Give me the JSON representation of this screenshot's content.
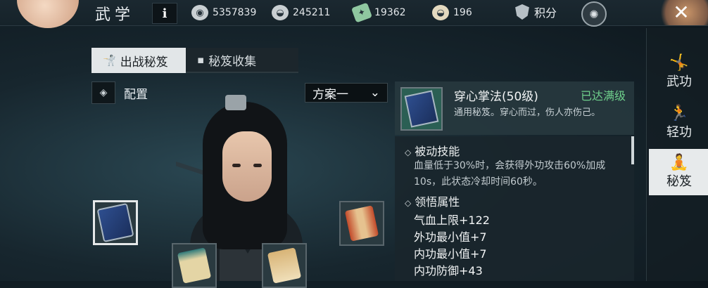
{
  "header": {
    "title": "武学",
    "info_label": "i",
    "resources": [
      {
        "icon": "coin-film-icon",
        "value": "5357839"
      },
      {
        "icon": "silver-ingot-icon",
        "value": "245211"
      },
      {
        "icon": "jade-ticket-icon",
        "value": "19362"
      },
      {
        "icon": "gold-ingot-icon",
        "value": "196"
      }
    ],
    "score_label": "积分"
  },
  "tabs": [
    {
      "label": "出战秘笈",
      "icon": "fighter-icon",
      "active": true
    },
    {
      "label": "秘笈收集",
      "icon": "chat-icon",
      "active": false
    }
  ],
  "config": {
    "label": "配置",
    "plan": "方案一"
  },
  "detail": {
    "name": "穿心掌法(50级)",
    "status": "已达满级",
    "desc": "通用秘笈。穿心而过，伤人亦伤己。",
    "passive_title": "被动技能",
    "passive_text": "血量低于30%时，会获得外功攻击60%加成10s，此状态冷却时间60秒。",
    "insight_title": "领悟属性",
    "attributes": [
      "气血上限+122",
      "外功最小值+7",
      "内功最小值+7",
      "内功防御+43"
    ]
  },
  "side_nav": [
    {
      "label": "武功",
      "icon": "martial-pose-icon",
      "active": false
    },
    {
      "label": "轻功",
      "icon": "leap-pose-icon",
      "active": false
    },
    {
      "label": "秘笈",
      "icon": "meditation-icon",
      "active": true
    }
  ],
  "colors": {
    "accent_green": "#6fd08c",
    "active_tab": "#e2e6e8",
    "panel_bg": "#1a262c"
  }
}
